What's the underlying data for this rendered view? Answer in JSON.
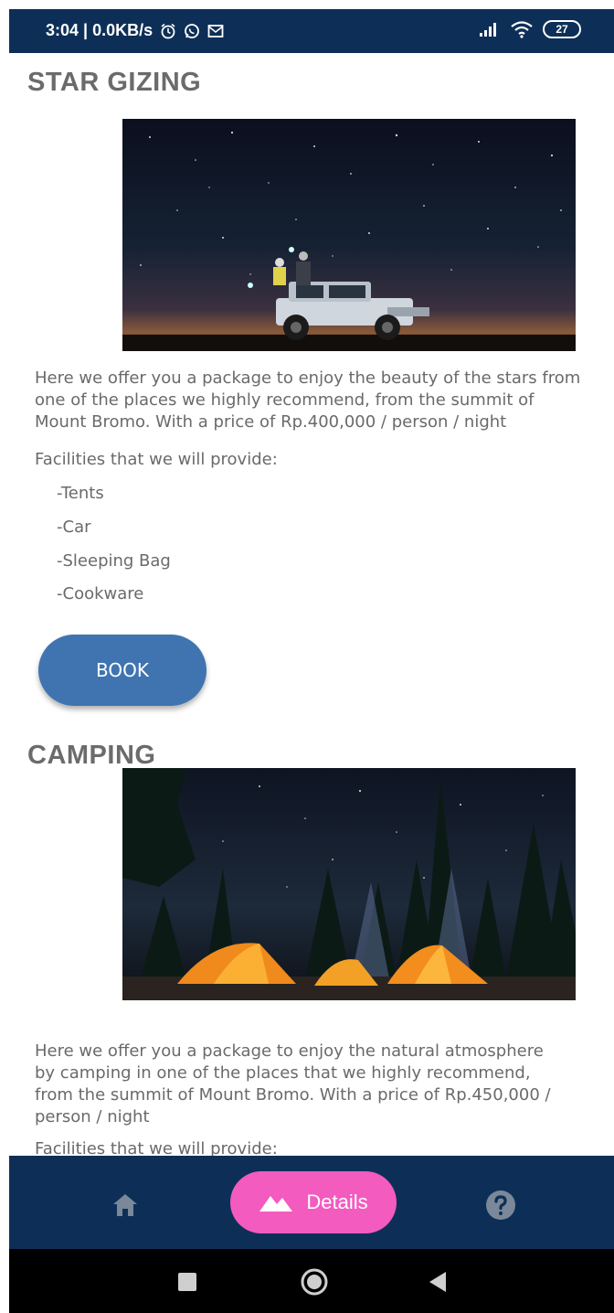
{
  "status_bar": {
    "time_and_speed": "3:04 | 0.0KB/s",
    "battery": "27",
    "icons": [
      "alarm-icon",
      "whatsapp-icon",
      "mail-icon",
      "signal-icon",
      "wifi-icon",
      "battery-icon"
    ]
  },
  "packages": [
    {
      "title": "STAR GIZING",
      "image": "starry-sky-jeep-photo",
      "description_lines": [
        "Here we offer you a package to enjoy the beauty of the stars from",
        "one of the places we highly recommend, from the summit of",
        "Mount Bromo. With a price of Rp.400,000 / person / night"
      ],
      "facilities_label": "Facilities that we will provide:",
      "facilities": [
        "-Tents",
        "-Car",
        "-Sleeping Bag",
        "-Cookware"
      ],
      "book_label": "BOOK"
    },
    {
      "title": "CAMPING",
      "image": "camping-tents-forest-photo",
      "description_lines": [
        "Here we offer you a package to enjoy the natural atmosphere",
        "by camping in one of the places that we highly recommend,",
        "from the summit of Mount Bromo. With a price of Rp.450,000 /",
        "person / night"
      ],
      "facilities_label": "Facilities that we will provide:"
    }
  ],
  "bottom_nav": {
    "home_icon": "home-icon",
    "details_label": "Details",
    "details_icon": "mountain-icon",
    "help_icon": "help-icon",
    "active_color": "#f35bbf",
    "bar_color": "#0d2f57"
  },
  "system_nav": [
    "recents-button",
    "home-button",
    "back-button"
  ]
}
